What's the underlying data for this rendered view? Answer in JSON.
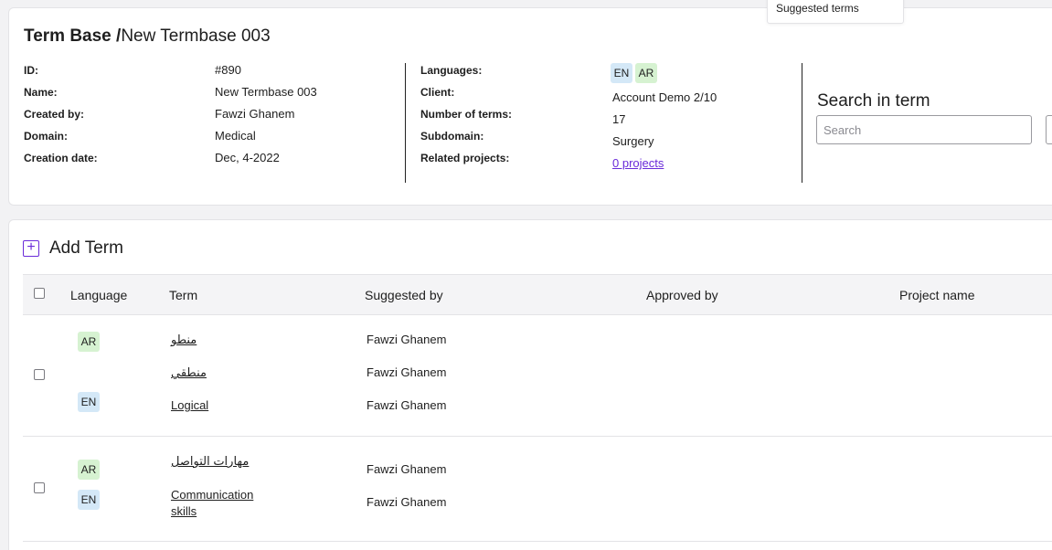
{
  "tooltip": {
    "text": "Suggested terms"
  },
  "header": {
    "title_prefix": "Term Base /",
    "title_name": "New Termbase 003",
    "left_fields": [
      {
        "label": "ID:",
        "value": "#890"
      },
      {
        "label": "Name:",
        "value": "New Termbase 003"
      },
      {
        "label": "Created by:",
        "value": "Fawzi Ghanem"
      },
      {
        "label": "Domain:",
        "value": "Medical"
      },
      {
        "label": "Creation date:",
        "value": "Dec, 4-2022"
      }
    ],
    "right_fields": {
      "languages_label": "Languages:",
      "languages": [
        "EN",
        "AR"
      ],
      "client_label": "Client:",
      "client": "Account Demo 2/10",
      "terms_label": "Number of terms:",
      "terms": "17",
      "subdomain_label": "Subdomain:",
      "subdomain": "Surgery",
      "projects_label": "Related projects:",
      "projects_link": "0 projects"
    },
    "search": {
      "title": "Search in term",
      "placeholder": "Search"
    }
  },
  "list": {
    "add_label": "Add Term",
    "columns": [
      "Language",
      "Term",
      "Suggested by",
      "Approved by",
      "Project name"
    ],
    "groups": [
      {
        "entries": [
          {
            "lang": "AR",
            "term": "منطو",
            "suggested_by": "Fawzi Ghanem"
          },
          {
            "lang": "",
            "term": "منطقي",
            "suggested_by": "Fawzi Ghanem"
          },
          {
            "lang": "EN",
            "term": "Logical",
            "suggested_by": "Fawzi Ghanem"
          }
        ]
      },
      {
        "entries": [
          {
            "lang": "AR",
            "term": "مهارات التواصل",
            "suggested_by": "Fawzi Ghanem"
          },
          {
            "lang": "EN",
            "term": "Communication skills",
            "suggested_by": "Fawzi Ghanem"
          }
        ]
      }
    ]
  },
  "colors": {
    "accent": "#6a2bd9",
    "en_badge": "#d4e8f7",
    "ar_badge": "#d6f2d1"
  }
}
